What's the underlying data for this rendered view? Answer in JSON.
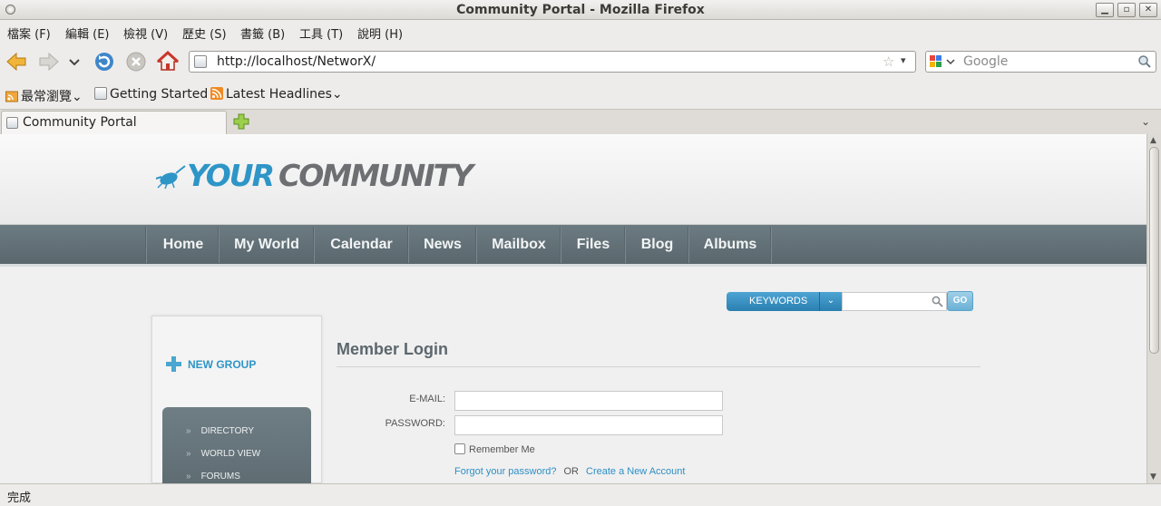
{
  "window": {
    "title": "Community Portal - Mozilla Firefox",
    "controls": {
      "minimize": "▁",
      "maximize": "▫",
      "close": "✕"
    }
  },
  "menubar": {
    "items": [
      "檔案 (F)",
      "編輯 (E)",
      "檢視 (V)",
      "歷史 (S)",
      "書籤 (B)",
      "工具 (T)",
      "說明 (H)"
    ]
  },
  "toolbar": {
    "url": "http://localhost/NetworX/",
    "search_placeholder": "Google"
  },
  "bookmarks": {
    "items": [
      "最常瀏覽",
      "Getting Started",
      "Latest Headlines"
    ]
  },
  "tabs": [
    {
      "label": "Community Portal",
      "active": true
    }
  ],
  "page": {
    "logo": {
      "part1": "YOUR",
      "part2": "COMMUNITY"
    },
    "nav": [
      "Home",
      "My World",
      "Calendar",
      "News",
      "Mailbox",
      "Files",
      "Blog",
      "Albums"
    ],
    "search": {
      "dropdown_label": "KEYWORDS",
      "caret": "⌄",
      "go_label": "GO"
    },
    "sidebar": {
      "new_group_label": "NEW GROUP",
      "menu_items": [
        "DIRECTORY",
        "WORLD VIEW",
        "FORUMS"
      ],
      "bullet": "»"
    },
    "login": {
      "title": "Member Login",
      "email_label": "E-MAIL:",
      "email_value": "",
      "password_label": "PASSWORD:",
      "password_value": "",
      "remember_label": "Remember Me",
      "remember_checked": false,
      "forgot_link": "Forgot your password?",
      "or_text": "OR",
      "create_link": "Create a New Account"
    }
  },
  "statusbar": {
    "text": "完成"
  },
  "colors": {
    "brand_blue": "#2e95c7",
    "nav_bg": "#62717a",
    "logo_grey": "#6d6f72"
  }
}
